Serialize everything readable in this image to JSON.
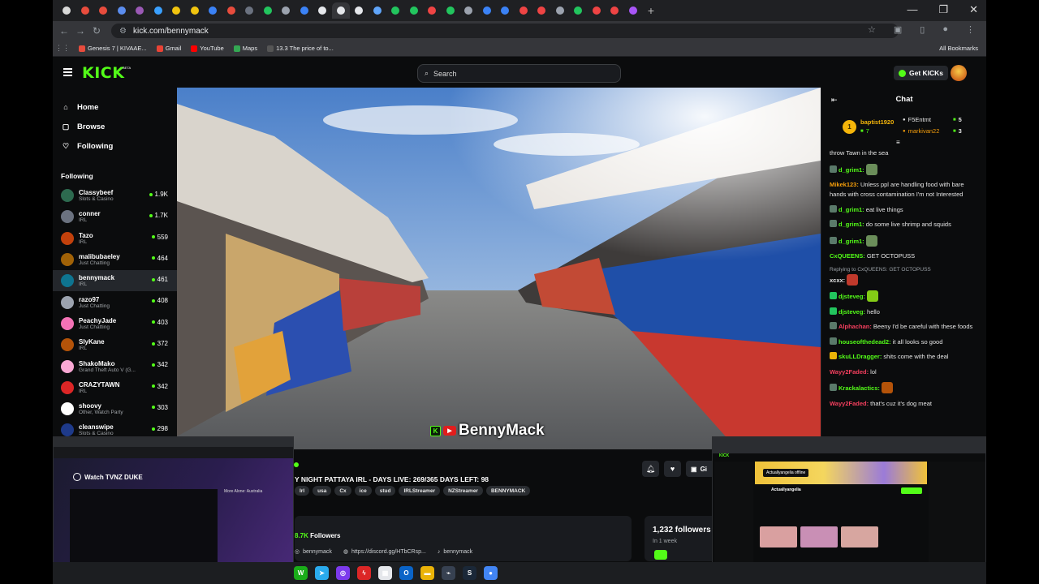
{
  "browser": {
    "url": "kick.com/bennymack",
    "tab_favicons": [
      "#d9d9d9",
      "#e84c3d",
      "#e84c3d",
      "#5b8def",
      "#9b59b6",
      "#3aa0ff",
      "#f1c40f",
      "#f1c40f",
      "#3b82f6",
      "#e84c3d",
      "#6b7280",
      "#22c55e",
      "#9ca3af",
      "#3b82f6",
      "#e5e7eb",
      "#e5e7eb",
      "#e5e7eb",
      "#60a5fa",
      "#22c55e",
      "#22c55e",
      "#ef4444",
      "#22c55e",
      "#9ca3af",
      "#3b82f6",
      "#3b82f6",
      "#ef4444",
      "#ef4444",
      "#9ca3af",
      "#22c55e",
      "#ef4444",
      "#ef4444",
      "#a855f7"
    ],
    "bookmarks": [
      {
        "label": "Genesis 7 | KIVAAE...",
        "color": "#e84c3d"
      },
      {
        "label": "Gmail",
        "color": "#ea4335"
      },
      {
        "label": "YouTube",
        "color": "#ff0000"
      },
      {
        "label": "Maps",
        "color": "#34a853"
      },
      {
        "label": "13.3 The price of to...",
        "color": "#555"
      }
    ],
    "all_bookmarks": "All Bookmarks"
  },
  "header": {
    "logo": "KICK",
    "logo_tag": "BETA",
    "search_placeholder": "Search",
    "get_kicks": "Get KICKs"
  },
  "sidebar": {
    "nav": [
      {
        "label": "Home",
        "icon": "home-icon",
        "glyph": "⌂"
      },
      {
        "label": "Browse",
        "icon": "browse-icon",
        "glyph": "▢"
      },
      {
        "label": "Following",
        "icon": "heart-icon",
        "glyph": "♡"
      }
    ],
    "following_title": "Following",
    "channels": [
      {
        "name": "Classybeef",
        "category": "Slots & Casino",
        "viewers": "1.9K",
        "color": "#2d6a4f"
      },
      {
        "name": "conner",
        "category": "IRL",
        "viewers": "1.7K",
        "color": "#6b7280"
      },
      {
        "name": "Tazo",
        "category": "IRL",
        "viewers": "559",
        "color": "#c2410c"
      },
      {
        "name": "malibubaeley",
        "category": "Just Chatting",
        "viewers": "464",
        "color": "#a16207"
      },
      {
        "name": "bennymack",
        "category": "IRL",
        "viewers": "461",
        "color": "#0e7490"
      },
      {
        "name": "razo97",
        "category": "Just Chatting",
        "viewers": "408",
        "color": "#9ca3af"
      },
      {
        "name": "PeachyJade",
        "category": "Just Chatting",
        "viewers": "403",
        "color": "#f472b6"
      },
      {
        "name": "SlyKane",
        "category": "IRL",
        "viewers": "372",
        "color": "#b45309"
      },
      {
        "name": "ShakoMako",
        "category": "Grand Theft Auto V (G...",
        "viewers": "342",
        "color": "#f9a8d4"
      },
      {
        "name": "CRAZYTAWN",
        "category": "IRL",
        "viewers": "342",
        "color": "#dc2626"
      },
      {
        "name": "shoovy",
        "category": "Other, Watch Party",
        "viewers": "303",
        "color": "#ffffff"
      },
      {
        "name": "cleanswipe",
        "category": "Slots & Casino",
        "viewers": "298",
        "color": "#1e3a8a"
      }
    ]
  },
  "video": {
    "watermark": "BennyMack"
  },
  "stream": {
    "title": "Y NIGHT PATTAYA IRL - DAYS LIVE: 269/365 DAYS LEFT: 98",
    "tags": [
      "Irl",
      "usa",
      "Cx",
      "ice",
      "stud",
      "IRLStreamer",
      "NZStreamer",
      "BENNYMACK"
    ],
    "gift_label": "Gi",
    "followers_num": "8.7K",
    "followers_label": "Followers",
    "links": [
      {
        "label": "bennymack",
        "icon": "instagram-icon"
      },
      {
        "label": "https://discord.gg/HTbCRsp...",
        "icon": "discord-icon"
      },
      {
        "label": "bennymack",
        "icon": "tiktok-icon"
      }
    ],
    "follower_stat": "1,232 followers to",
    "follower_period": "In 1 week"
  },
  "chat": {
    "title": "Chat",
    "leaders": [
      {
        "name": "baptist1920",
        "count": "7",
        "color": "#f5b50a"
      },
      {
        "name": "F5Entmt",
        "count": "5",
        "color": "#e6e6e6"
      },
      {
        "name": "markivan22",
        "count": "3",
        "color": "#f59e0b"
      }
    ],
    "leader_rank": "1",
    "messages": [
      {
        "user": "",
        "text": "throw Tawn in the sea",
        "color": "#e6e6e6",
        "badge": "",
        "emote": ""
      },
      {
        "user": "d_grim1:",
        "text": "",
        "color": "#53fc18",
        "badge": "#5a7a6a",
        "emote": "#6b8e5a"
      },
      {
        "user": "Mikek123:",
        "text": " Unless ppl are handling food with bare hands with cross contamination I'm not Interested",
        "color": "#f59e0b",
        "badge": "",
        "emote": ""
      },
      {
        "user": "d_grim1:",
        "text": " eat live things",
        "color": "#53fc18",
        "badge": "#5a7a6a",
        "emote": ""
      },
      {
        "user": "d_grim1:",
        "text": " do some live shrimp and squids",
        "color": "#53fc18",
        "badge": "#5a7a6a",
        "emote": ""
      },
      {
        "user": "d_grim1:",
        "text": "",
        "color": "#53fc18",
        "badge": "#5a7a6a",
        "emote": "#6b8e5a"
      },
      {
        "user": "CxQUEENS:",
        "text": " GET OCTOPUSS",
        "color": "#53fc18",
        "badge": "",
        "emote": ""
      },
      {
        "user": "xcxx:",
        "text": "",
        "color": "#e6e6e6",
        "badge": "",
        "emote": "#c0392b",
        "reply": "Replying to CxQUEENS: GET OCTOPUSS"
      },
      {
        "user": "djsteveg:",
        "text": "",
        "color": "#53fc18",
        "badge": "#22c55e",
        "emote": "#84cc16"
      },
      {
        "user": "djsteveg:",
        "text": " hello",
        "color": "#53fc18",
        "badge": "#22c55e",
        "emote": ""
      },
      {
        "user": "Alphachan:",
        "text": " Beeny I'd be careful with these foods",
        "color": "#f43f5e",
        "badge": "#5a7a6a",
        "emote": ""
      },
      {
        "user": "houseofthedead2:",
        "text": " it all looks so good",
        "color": "#53fc18",
        "badge": "#5a7a6a",
        "emote": ""
      },
      {
        "user": "skuLLDragger:",
        "text": " shits come with the deal",
        "color": "#53fc18",
        "badge": "#eab308",
        "emote": ""
      },
      {
        "user": "Wayy2Faded:",
        "text": " lol",
        "color": "#f43f5e",
        "badge": "",
        "emote": ""
      },
      {
        "user": "Krackalactics:",
        "text": "",
        "color": "#53fc18",
        "badge": "#5a7a6a",
        "emote": "#b45309"
      },
      {
        "user": "Wayy2Faded:",
        "text": " that's cuz it's dog meat",
        "color": "#f43f5e",
        "badge": "",
        "emote": ""
      }
    ]
  },
  "overlay_left": {
    "title": "Watch TVNZ DUKE",
    "promo_title": "More Alone: Australia"
  },
  "overlay_right": {
    "logo": "KICK",
    "offline": "Actuallyangelia offline",
    "name": "Actuallyangelia"
  },
  "taskbar": {
    "apps": [
      {
        "name": "wechat",
        "color": "#1aad19",
        "glyph": "W"
      },
      {
        "name": "telegram",
        "color": "#2aabee",
        "glyph": "➤"
      },
      {
        "name": "app-purple",
        "color": "#7c3aed",
        "glyph": "◎"
      },
      {
        "name": "app-red",
        "color": "#dc2626",
        "glyph": "ϟ"
      },
      {
        "name": "calendar",
        "color": "#e5e7eb",
        "glyph": "▦"
      },
      {
        "name": "outlook",
        "color": "#0a64c8",
        "glyph": "O"
      },
      {
        "name": "folder",
        "color": "#eab308",
        "glyph": "▬"
      },
      {
        "name": "app-grey",
        "color": "#374151",
        "glyph": "⌁"
      },
      {
        "name": "steam",
        "color": "#1b2838",
        "glyph": "S"
      },
      {
        "name": "chrome",
        "color": "#4285f4",
        "glyph": "●"
      }
    ]
  }
}
